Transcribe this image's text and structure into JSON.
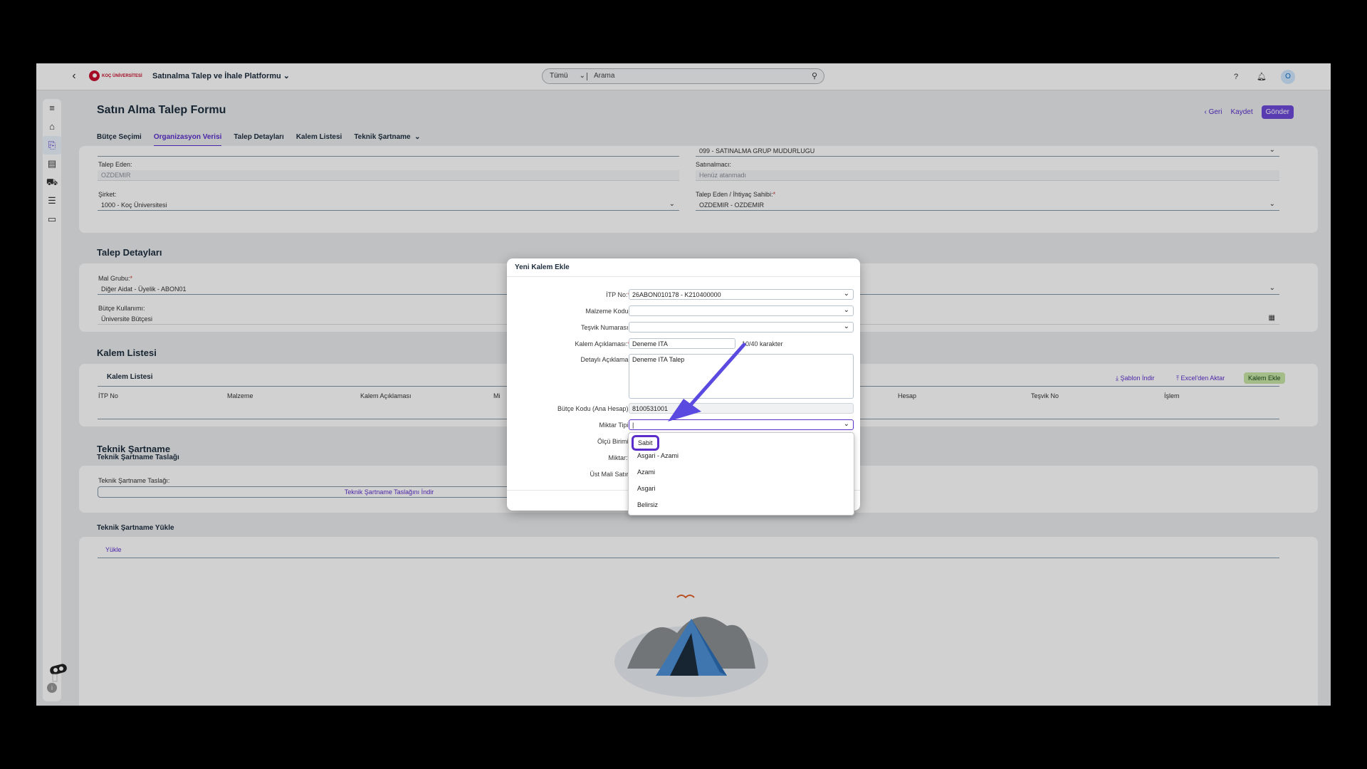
{
  "shell": {
    "product": "Satınalma Talep ve İhale Platformu ⌄",
    "logo_text": "KOÇ ÜNİVERSİTESİ",
    "search_scope": "Tümü",
    "search_placeholder": "Arama",
    "avatar": "O"
  },
  "page": {
    "title": "Satın Alma Talep Formu",
    "actions": {
      "back": "Geri",
      "save": "Kaydet",
      "send": "Gönder"
    },
    "tabs": [
      "Bütçe Seçimi",
      "Organizasyon Verisi",
      "Talep Detayları",
      "Kalem Listesi",
      "Teknik Şartname"
    ],
    "active_tab": "Organizasyon Verisi"
  },
  "org": {
    "group_value": "099 - SATINALMA GRUP MUDURLUGU",
    "requester_label": "Talep Eden:",
    "requester_value": "OZDEMIR",
    "buyer_label": "Satınalmacı:",
    "buyer_value": "Henüz atanmadı",
    "company_label": "Şirket:",
    "company_value": "1000 - Koç Üniversitesi",
    "owner_label": "Talep Eden / İhtiyaç Sahibi:",
    "owner_value": "OZDEMIR - OZDEMIR"
  },
  "details": {
    "title": "Talep Detayları",
    "material_group_label": "Mal Grubu:",
    "material_group_value": "Diğer Aidat - Üyelik - ABON01",
    "budget_use_label": "Bütçe Kullanımı:",
    "budget_use_value": "Üniversite Bütçesi"
  },
  "items": {
    "section_title": "Kalem Listesi",
    "table_title": "Kalem Listesi",
    "download_template": "Şablon İndir",
    "excel_import": "Excel'den Aktar",
    "add_item": "Kalem Ekle",
    "columns": [
      "İTP No",
      "Malzeme",
      "Kalem Açıklaması",
      "Mi",
      "Hesap",
      "Teşvik No",
      "İşlem"
    ]
  },
  "spec": {
    "title": "Teknik Şartname",
    "draft_subtitle": "Teknik Şartname Taslağı",
    "draft_label": "Teknik Şartname Taslağı:",
    "download_draft": "Teknik Şartname Taslağını İndir",
    "upload_subtitle": "Teknik Şartname Yükle",
    "upload": "Yükle"
  },
  "dialog": {
    "title": "Yeni Kalem Ekle",
    "itp_label": "İTP No:",
    "itp_value": "26ABON010178 - K210400000",
    "material_code_label": "Malzeme Kodu:",
    "incentive_label": "Teşvik Numarası:",
    "item_desc_label": "Kalem Açıklaması:",
    "item_desc_value": "Deneme ITA",
    "char_count": "10/40 karakter",
    "detail_desc_label": "Detaylı Açıklama:",
    "detail_desc_value": "Deneme ITA Talep",
    "budget_code_label": "Bütçe Kodu (Ana Hesap):",
    "budget_code_value": "8100531001",
    "qty_type_label": "Miktar Tipi:",
    "unit_label": "Ölçü Birimi:",
    "qty_label": "Miktar:",
    "parent_row_label": "Üst Mali Satır:"
  },
  "dropdown": {
    "options": [
      "Sabit",
      "Asgari - Azami",
      "Azami",
      "Asgari",
      "Belirsiz"
    ],
    "highlighted": "Sabit"
  }
}
